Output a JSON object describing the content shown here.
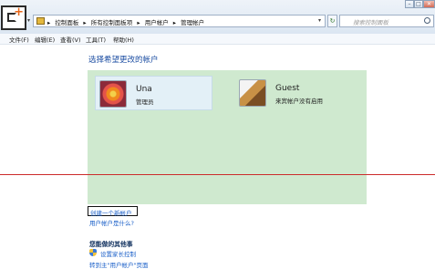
{
  "address_bar": {
    "crumbs": [
      "控制面板",
      "所有控制面板项",
      "用户帐户",
      "管理帐户"
    ],
    "separator": "▸",
    "search_placeholder": "搜索控制面板"
  },
  "window_controls": {
    "minimize": "–",
    "maximize": "□",
    "close": "✕"
  },
  "menu": [
    "文件(F)",
    "编辑(E)",
    "查看(V)",
    "工具(T)",
    "帮助(H)"
  ],
  "content": {
    "title": "选择希望更改的帐户",
    "accounts": [
      {
        "name": "Una",
        "role": "管理员"
      },
      {
        "name": "Guest",
        "role": "来宾帐户没有启用"
      }
    ],
    "create_link": "创建一个新帐户",
    "what_link": "用户帐户是什么?",
    "other_heading": "您能做的其他事",
    "parental_link": "设置家长控制",
    "goto_link": "转到主\"用户帐户\"页面"
  },
  "colors": {
    "accent": "#1e4fa3",
    "panel": "#cfe9cf",
    "red_line": "#cc2b2b"
  }
}
